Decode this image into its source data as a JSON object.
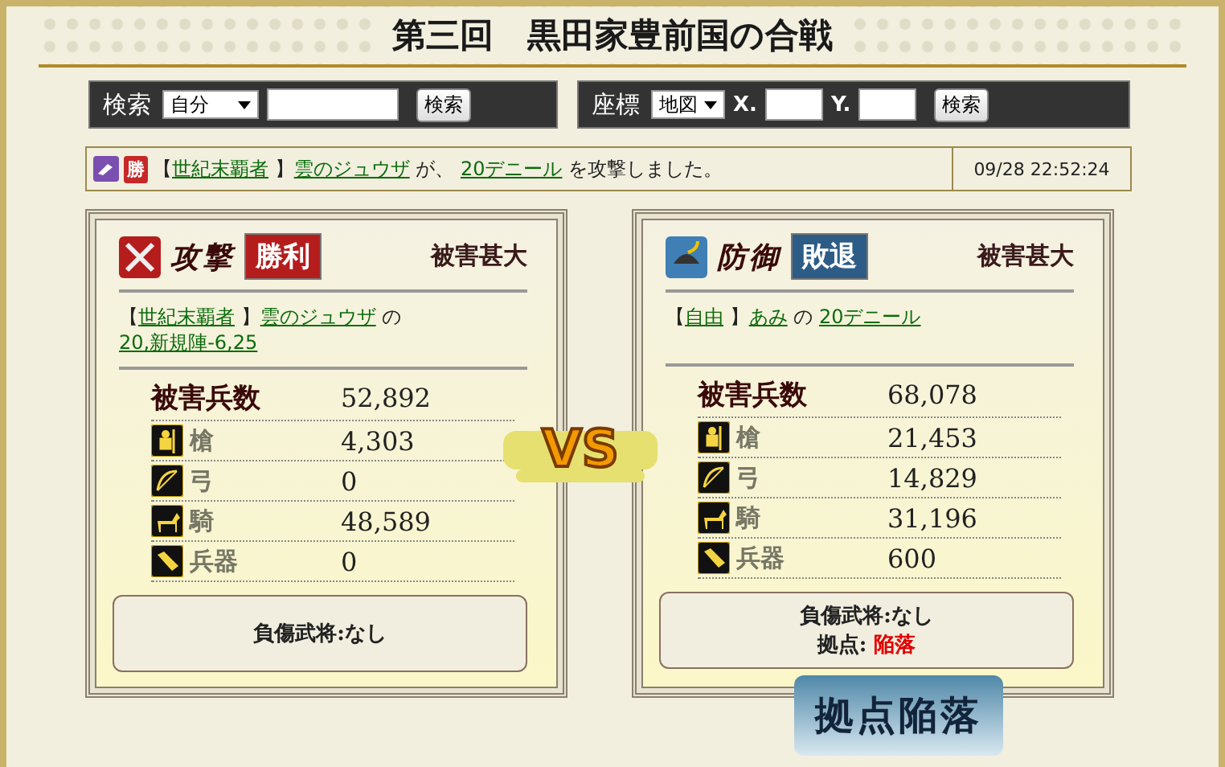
{
  "title": "第三回　黒田家豊前国の合戦",
  "search_bars": [
    {
      "kind": "search",
      "label": "検索",
      "select": "自分",
      "button": "検索"
    },
    {
      "kind": "coords",
      "label": "座標",
      "select": "地図",
      "x_label": "X.",
      "y_label": "Y.",
      "button": "検索"
    }
  ],
  "log": {
    "badge": "勝",
    "segments": [
      {
        "kind": "text",
        "text": "【"
      },
      {
        "kind": "link",
        "text": "世紀末覇者"
      },
      {
        "kind": "text",
        "text": " 】"
      },
      {
        "kind": "link",
        "text": "雲のジュウザ"
      },
      {
        "kind": "text",
        "text": " が、 "
      },
      {
        "kind": "link",
        "text": "20デニール"
      },
      {
        "kind": "text",
        "text": " を攻撃しました。"
      }
    ],
    "time": "09/28 22:52:24"
  },
  "sides": [
    {
      "kind": "attack",
      "role_label": "攻撃",
      "result": "勝利",
      "damage": "被害甚大",
      "info": [
        {
          "kind": "text",
          "text": "【"
        },
        {
          "kind": "link",
          "text": "世紀末覇者"
        },
        {
          "kind": "text",
          "text": " 】"
        },
        {
          "kind": "link",
          "text": "雲のジュウザ"
        },
        {
          "kind": "text",
          "text": " の "
        },
        {
          "kind": "link",
          "text": "20,新規陣-6,25"
        }
      ],
      "total_label": "被害兵数",
      "total": "52,892",
      "units": [
        {
          "kind": "spear",
          "name": "槍",
          "value": "4,303"
        },
        {
          "kind": "bow",
          "name": "弓",
          "value": "0"
        },
        {
          "kind": "horse",
          "name": "騎",
          "value": "48,589"
        },
        {
          "kind": "weapon",
          "name": "兵器",
          "value": "0"
        }
      ],
      "notes": [
        {
          "kind": "plain",
          "text": "負傷武将:なし"
        }
      ]
    },
    {
      "kind": "defense",
      "role_label": "防御",
      "result": "敗退",
      "damage": "被害甚大",
      "info": [
        {
          "kind": "text",
          "text": "【"
        },
        {
          "kind": "link",
          "text": "自由"
        },
        {
          "kind": "text",
          "text": " 】"
        },
        {
          "kind": "link",
          "text": "あみ"
        },
        {
          "kind": "text",
          "text": " の "
        },
        {
          "kind": "link",
          "text": "20デニール"
        }
      ],
      "total_label": "被害兵数",
      "total": "68,078",
      "units": [
        {
          "kind": "spear",
          "name": "槍",
          "value": "21,453"
        },
        {
          "kind": "bow",
          "name": "弓",
          "value": "14,829"
        },
        {
          "kind": "horse",
          "name": "騎",
          "value": "31,196"
        },
        {
          "kind": "weapon",
          "name": "兵器",
          "value": "600"
        }
      ],
      "notes": [
        {
          "kind": "plain",
          "text": "負傷武将:なし"
        },
        {
          "kind": "alert",
          "label": "拠点:",
          "value": "陥落"
        }
      ]
    }
  ],
  "vs": "VS",
  "banner": "拠点陥落"
}
